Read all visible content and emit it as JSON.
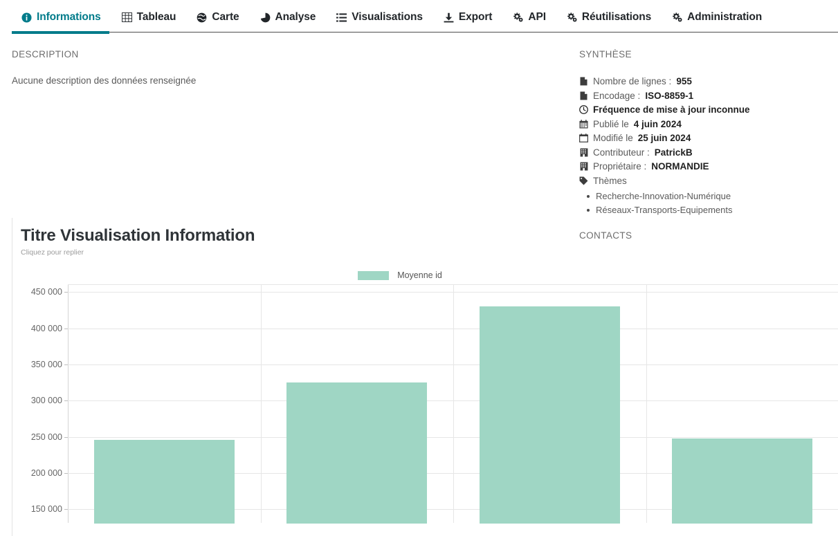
{
  "tabs": [
    {
      "label": "Informations",
      "icon": "info-icon",
      "active": true
    },
    {
      "label": "Tableau",
      "icon": "table-icon",
      "active": false
    },
    {
      "label": "Carte",
      "icon": "globe-icon",
      "active": false
    },
    {
      "label": "Analyse",
      "icon": "pie-chart-icon",
      "active": false
    },
    {
      "label": "Visualisations",
      "icon": "list-icon",
      "active": false
    },
    {
      "label": "Export",
      "icon": "download-icon",
      "active": false
    },
    {
      "label": "API",
      "icon": "gears-icon",
      "active": false
    },
    {
      "label": "Réutilisations",
      "icon": "gears-icon",
      "active": false
    },
    {
      "label": "Administration",
      "icon": "gears-icon",
      "active": false
    }
  ],
  "description": {
    "heading": "DESCRIPTION",
    "text": "Aucune description des données renseignée"
  },
  "synthese": {
    "heading": "SYNTHÈSE",
    "rows": [
      {
        "icon": "file-icon",
        "label": "Nombre de lignes : ",
        "value": "955",
        "bold_all": false
      },
      {
        "icon": "file-icon",
        "label": "Encodage : ",
        "value": "ISO-8859-1",
        "bold_all": false
      },
      {
        "icon": "clock-icon",
        "label": "Fréquence de mise à jour inconnue",
        "value": "",
        "bold_all": true
      },
      {
        "icon": "calendar-icon",
        "label": "Publié le ",
        "value": "4 juin 2024",
        "bold_all": false
      },
      {
        "icon": "calendar2-icon",
        "label": "Modifié le ",
        "value": "25 juin 2024",
        "bold_all": false
      },
      {
        "icon": "building-icon",
        "label": "Contributeur : ",
        "value": "PatrickB",
        "bold_all": false
      },
      {
        "icon": "building-icon",
        "label": "Propriétaire : ",
        "value": "NORMANDIE",
        "bold_all": false
      },
      {
        "icon": "tag-icon",
        "label": "Thèmes",
        "value": "",
        "bold_all": false
      }
    ],
    "themes": [
      "Recherche-Innovation-Numérique",
      "Réseaux-Transports-Equipements"
    ]
  },
  "contacts": {
    "heading": "CONTACTS"
  },
  "visualisation": {
    "title": "Titre Visualisation Information",
    "subtitle": "Cliquez pour replier"
  },
  "chart_data": {
    "type": "bar",
    "title": "Titre Visualisation Information",
    "xlabel": "",
    "ylabel": "",
    "grid": true,
    "legend_position": "top",
    "bar_color": "#9fd6c4",
    "categories": [
      "",
      "",
      "",
      ""
    ],
    "series": [
      {
        "name": "Moyenne id",
        "values": [
          246000,
          325000,
          430000,
          248000
        ]
      }
    ],
    "ylim": [
      130000,
      460000
    ],
    "yticks": [
      450000,
      400000,
      350000,
      300000,
      250000,
      200000,
      150000
    ],
    "ytick_labels": [
      "450 000",
      "400 000",
      "350 000",
      "300 000",
      "250 000",
      "200 000",
      "150 000"
    ]
  }
}
